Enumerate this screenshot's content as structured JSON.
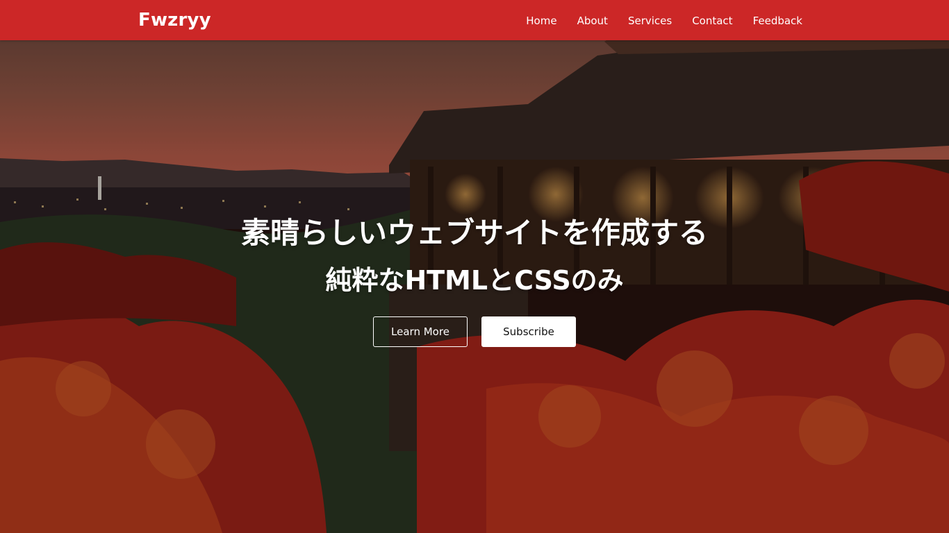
{
  "navbar": {
    "brand": "Fwzryy",
    "links": [
      {
        "label": "Home"
      },
      {
        "label": "About"
      },
      {
        "label": "Services"
      },
      {
        "label": "Contact"
      },
      {
        "label": "Feedback"
      }
    ],
    "background_color": "#cc2727"
  },
  "hero": {
    "title": "素晴らしいウェブサイトを作成する",
    "subtitle": "純粋なHTMLとCSSのみ",
    "buttons": {
      "learn_more": "Learn More",
      "subscribe": "Subscribe"
    },
    "background_image": "kiyomizu-dera-autumn-sunset-photo"
  }
}
